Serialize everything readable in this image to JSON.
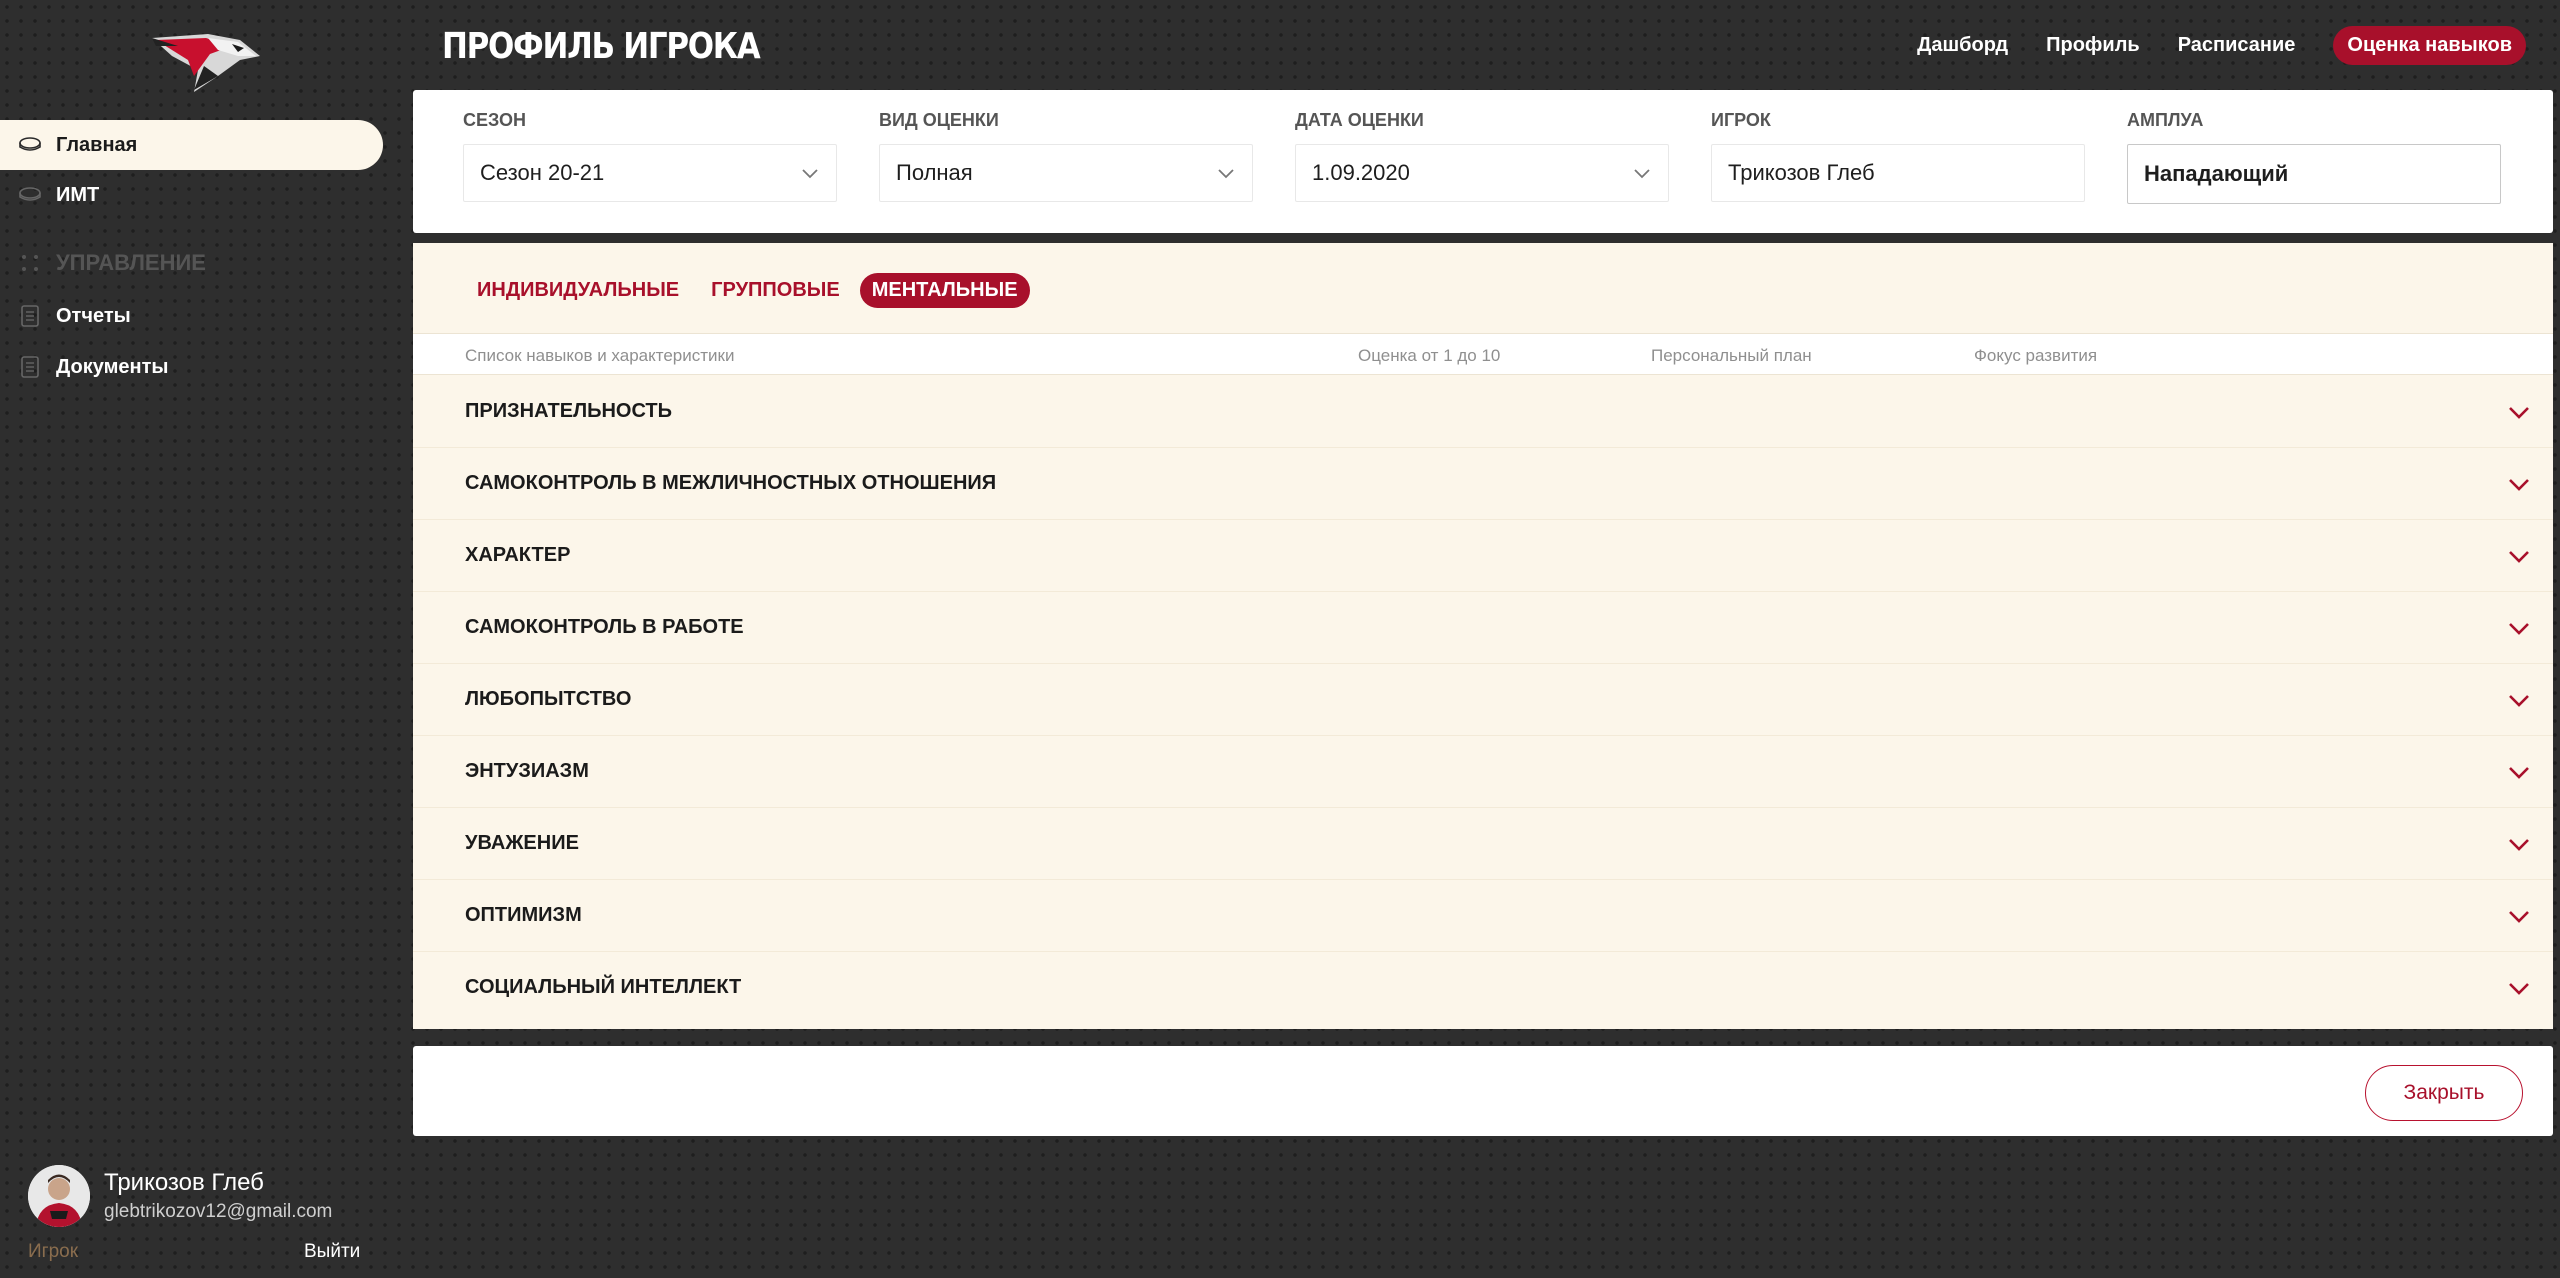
{
  "app": {
    "page_title": "ПРОФИЛЬ ИГРОКА"
  },
  "sidebar": {
    "items": [
      {
        "label": "Главная",
        "icon": "puck-icon",
        "active": true
      },
      {
        "label": "ИМТ",
        "icon": "puck-icon",
        "active": false
      }
    ],
    "section_label": "УПРАВЛЕНИЕ",
    "section_items": [
      {
        "label": "Отчеты",
        "icon": "document-icon"
      },
      {
        "label": "Документы",
        "icon": "document-icon"
      }
    ]
  },
  "header": {
    "nav": [
      {
        "label": "Дашборд",
        "active": false
      },
      {
        "label": "Профиль",
        "active": false
      },
      {
        "label": "Расписание",
        "active": false
      },
      {
        "label": "Оценка навыков",
        "active": true
      }
    ]
  },
  "filters": [
    {
      "label": "Сезон",
      "value": "Сезон 20-21",
      "dropdown": true
    },
    {
      "label": "Вид оценки",
      "value": "Полная",
      "dropdown": true
    },
    {
      "label": "Дата оценки",
      "value": "1.09.2020",
      "dropdown": true
    },
    {
      "label": "Игрок",
      "value": "Трикозов Глеб",
      "dropdown": false
    },
    {
      "label": "Амплуа",
      "value": "Нападающий",
      "dropdown": false
    }
  ],
  "skills": {
    "tabs": [
      {
        "label": "Индивидуальные",
        "active": false
      },
      {
        "label": "Групповые",
        "active": false
      },
      {
        "label": "Ментальные",
        "active": true
      }
    ],
    "columns": [
      "Список навыков и характеристики",
      "Оценка от 1 до 10",
      "Персональный план",
      "Фокус развития"
    ],
    "rows": [
      "Признательность",
      "Самоконтроль в межличностных отношения",
      "Характер",
      "Самоконтроль в работе",
      "Любопытство",
      "Энтузиазм",
      "Уважение",
      "Оптимизм",
      "Социальный интеллект"
    ]
  },
  "footer": {
    "close_label": "Закрыть"
  },
  "user": {
    "name": "Трикозов Глеб",
    "email": "glebtrikozov12@gmail.com",
    "role": "Игрок",
    "logout_label": "Выйти"
  },
  "colors": {
    "accent": "#a8102b",
    "panel": "#fcf6ea",
    "background": "#2e2e2e"
  }
}
